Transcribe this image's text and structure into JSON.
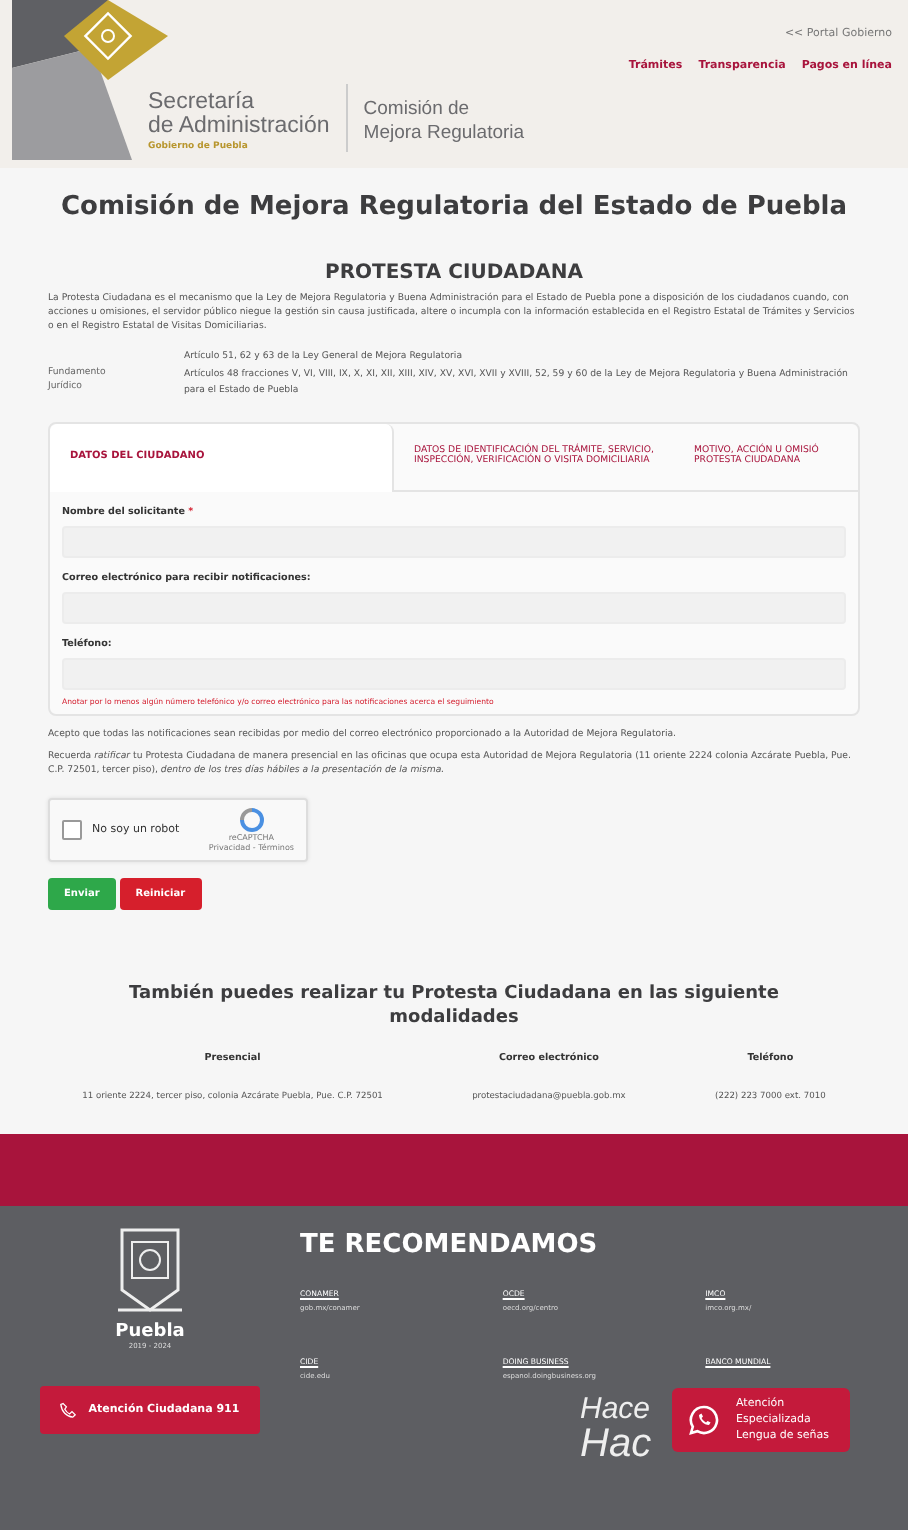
{
  "header": {
    "secretaria": "Secretaría",
    "administracion": "de Administración",
    "gobierno": "Gobierno de Puebla",
    "comision": "Comisión de",
    "mejora": "Mejora Regulatoria",
    "portal_link": "<< Portal Gobierno",
    "nav": [
      "Trámites",
      "Transparencia",
      "Pagos en línea"
    ]
  },
  "title": "Comisión de Mejora Regulatoria del Estado de Puebla",
  "subtitle": "PROTESTA CIUDADANA",
  "intro": "La Protesta Ciudadana es el mecanismo que la Ley de Mejora Regulatoria y Buena Administración para el Estado de Puebla pone a disposición de los ciudadanos cuando, con acciones u omisiones, el servidor público niegue la gestión sin causa justificada, altere o incumpla con la información establecida en el Registro Estatal de Trámites y Servicios o en el Registro Estatal de Visitas Domiciliarias.",
  "fundamento": {
    "label": "Fundamento Jurídico",
    "items": [
      "Artículo 51, 62 y 63 de la Ley General de Mejora Regulatoria",
      "Artículos 48 fracciones V, VI, VIII, IX, X, XI, XII, XIII, XIV, XV, XVI, XVII y XVIII, 52, 59 y 60 de la Ley de Mejora Regulatoria y Buena Administración para el Estado de Puebla"
    ]
  },
  "tabs": [
    {
      "label": "DATOS DEL CIUDADANO",
      "selected": true
    },
    {
      "label": "DATOS DE IDENTIFICACIÓN DEL TRÁMITE, SERVICIO, INSPECCIÓN, VERIFICACIÓN O VISITA DOMICILIARIA",
      "selected": false
    },
    {
      "label": "MOTIVO, ACCIÓN U OMISIÓ PROTESTA CIUDADANA",
      "selected": false
    }
  ],
  "fields": [
    {
      "label": "Nombre del solicitante",
      "required": true
    },
    {
      "label": "Correo electrónico para recibir notificaciones:",
      "required": false
    },
    {
      "label": "Teléfono:",
      "required": false
    }
  ],
  "required_mark": "*",
  "hint": "Anotar por lo menos algún número telefónico y/o correo electrónico para las notificaciones acerca el seguimiento",
  "accept_text": "Acepto que todas las notificaciones sean recibidas por medio del correo electrónico proporcionado a la Autoridad de Mejora Regulatoria.",
  "reminder": "Recuerda *ratificar* tu Protesta Ciudadana de manera presencial en las oficinas que ocupa esta Autoridad de Mejora Regulatoria (11 oriente 2224 colonia Azcárate Puebla, Pue. C.P. 72501, tercer piso), *dentro de los tres días hábiles a la presentación de la misma.*",
  "captcha": {
    "label": "No soy un robot",
    "checked": false,
    "brand": "reCAPTCHA",
    "links": "Privacidad - Términos"
  },
  "buttons": [
    {
      "label": "Enviar",
      "kind": "submit"
    },
    {
      "label": "Reiniciar",
      "kind": "reset"
    }
  ],
  "modalities": {
    "heading": "También puedes realizar tu Protesta Ciudadana en las siguiente modalidades",
    "columns": [
      "Presencial",
      "Correo electrónico",
      "Teléfono"
    ],
    "row": [
      "11 oriente 2224, tercer piso, colonia Azcárate Puebla, Pue. C.P. 72501",
      "protestaciudadana@puebla.gob.mx",
      "(222) 223 7000 ext. 7010"
    ]
  },
  "footer": {
    "brand": "Puebla",
    "years": "2019 - 2024",
    "call_button": "Atención Ciudadana 911",
    "heading": "TE RECOMENDAMOS",
    "links": [
      {
        "name": "CONAMER",
        "url": "gob.mx/conamer"
      },
      {
        "name": "OCDE",
        "url": "oecd.org/centro"
      },
      {
        "name": "IMCO",
        "url": "imco.org.mx/"
      },
      {
        "name": "CIDE",
        "url": "cide.edu"
      },
      {
        "name": "DOING BUSINESS",
        "url": "espanol.doingbusiness.org"
      },
      {
        "name": "BANCO MUNDIAL"
      }
    ],
    "slogan": [
      "Hace",
      "Hac"
    ],
    "sign_button": [
      "Atención",
      "Especializada",
      "Lengua de señas"
    ]
  }
}
